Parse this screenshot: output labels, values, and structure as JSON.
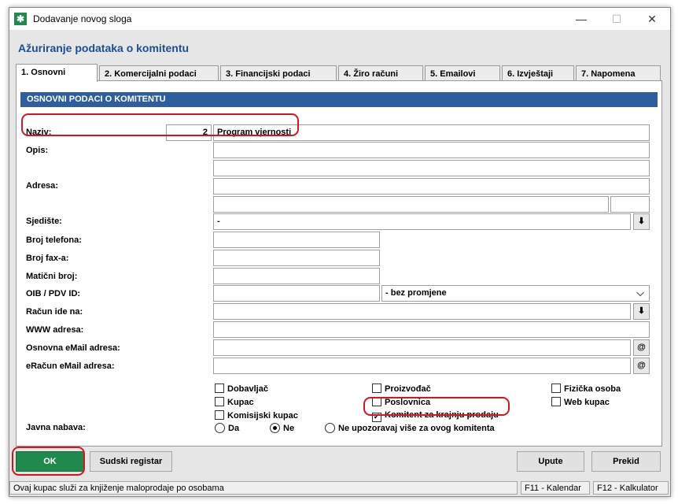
{
  "window": {
    "title": "Dodavanje novog sloga",
    "minimize": "—",
    "maximize": "☐",
    "close": "✕"
  },
  "header": {
    "title": "Ažuriranje podataka o komitentu"
  },
  "tabs": [
    {
      "label": "1. Osnovni"
    },
    {
      "label": "2. Komercijalni podaci"
    },
    {
      "label": "3. Financijski podaci"
    },
    {
      "label": "4. Žiro računi"
    },
    {
      "label": "5. Emailovi"
    },
    {
      "label": "6. Izvještaji"
    },
    {
      "label": "7. Napomena"
    }
  ],
  "section": {
    "title": "OSNOVNI PODACI O KOMITENTU"
  },
  "form": {
    "naziv_label": "Naziv:",
    "naziv_code": "2",
    "naziv_value": "Program vjernosti",
    "opis_label": "Opis:",
    "adresa_label": "Adresa:",
    "sjediste_label": "Sjedište:",
    "sjediste_value": "-",
    "telefon_label": "Broj telefona:",
    "fax_label": "Broj fax-a:",
    "maticni_label": "Matični broj:",
    "oib_label": "OIB / PDV ID:",
    "oib_select_value": "- bez promjene",
    "racun_label": "Račun ide na:",
    "www_label": "WWW adresa:",
    "email_label": "Osnovna eMail adresa:",
    "eracun_label": "eRačun eMail adresa:",
    "javna_label": "Javna nabava:"
  },
  "icons": {
    "download": "⬇",
    "at": "@",
    "chevron": "⌵",
    "check": "✓"
  },
  "checkboxes": {
    "dobavljac": "Dobavljač",
    "kupac": "Kupac",
    "komisijski": "Komisijski kupac",
    "proizvodac": "Proizvođač",
    "poslovnica": "Poslovnica",
    "komitent_krajnja": "Komitent za krajnju prodaju",
    "fizicka": "Fizička osoba",
    "web_kupac": "Web kupac"
  },
  "radios": {
    "da": "Da",
    "ne": "Ne",
    "ne_upozoravaj": "Ne upozoravaj više za ovog komitenta"
  },
  "buttons": {
    "ok": "OK",
    "sudski": "Sudski registar",
    "upute": "Upute",
    "prekid": "Prekid"
  },
  "status": {
    "message": "Ovaj kupac služi za knjiženje maloprodaje po osobama",
    "f11": "F11 - Kalendar",
    "f12": "F12 - Kalkulator"
  },
  "colors": {
    "accent": "#1f4e8c",
    "section_bar": "#2f5e9e",
    "ok_green": "#1f8a4c",
    "highlight_red": "#d9141e"
  }
}
